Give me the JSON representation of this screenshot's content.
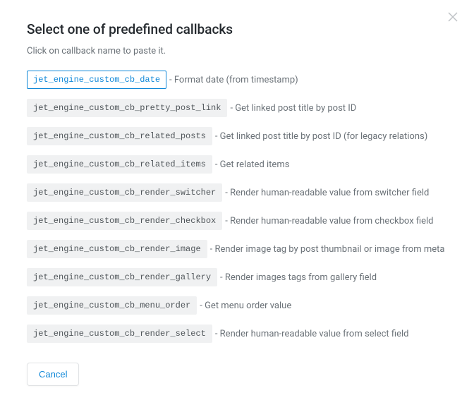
{
  "modal": {
    "title": "Select one of predefined callbacks",
    "subtitle": "Click on callback name to paste it.",
    "close_icon": "close",
    "cancel_label": "Cancel"
  },
  "callbacks": [
    {
      "name": "jet_engine_custom_cb_date",
      "description": "Format date (from timestamp)",
      "selected": true
    },
    {
      "name": "jet_engine_custom_cb_pretty_post_link",
      "description": "Get linked post title by post ID",
      "selected": false
    },
    {
      "name": "jet_engine_custom_cb_related_posts",
      "description": "Get linked post title by post ID (for legacy relations)",
      "selected": false
    },
    {
      "name": "jet_engine_custom_cb_related_items",
      "description": "Get related items",
      "selected": false
    },
    {
      "name": "jet_engine_custom_cb_render_switcher",
      "description": "Render human-readable value from switcher field",
      "selected": false
    },
    {
      "name": "jet_engine_custom_cb_render_checkbox",
      "description": "Render human-readable value from checkbox field",
      "selected": false
    },
    {
      "name": "jet_engine_custom_cb_render_image",
      "description": "Render image tag by post thumbnail or image from meta",
      "selected": false
    },
    {
      "name": "jet_engine_custom_cb_render_gallery",
      "description": "Render images tags from gallery field",
      "selected": false
    },
    {
      "name": "jet_engine_custom_cb_menu_order",
      "description": "Get menu order value",
      "selected": false
    },
    {
      "name": "jet_engine_custom_cb_render_select",
      "description": "Render human-readable value from select field",
      "selected": false
    }
  ]
}
